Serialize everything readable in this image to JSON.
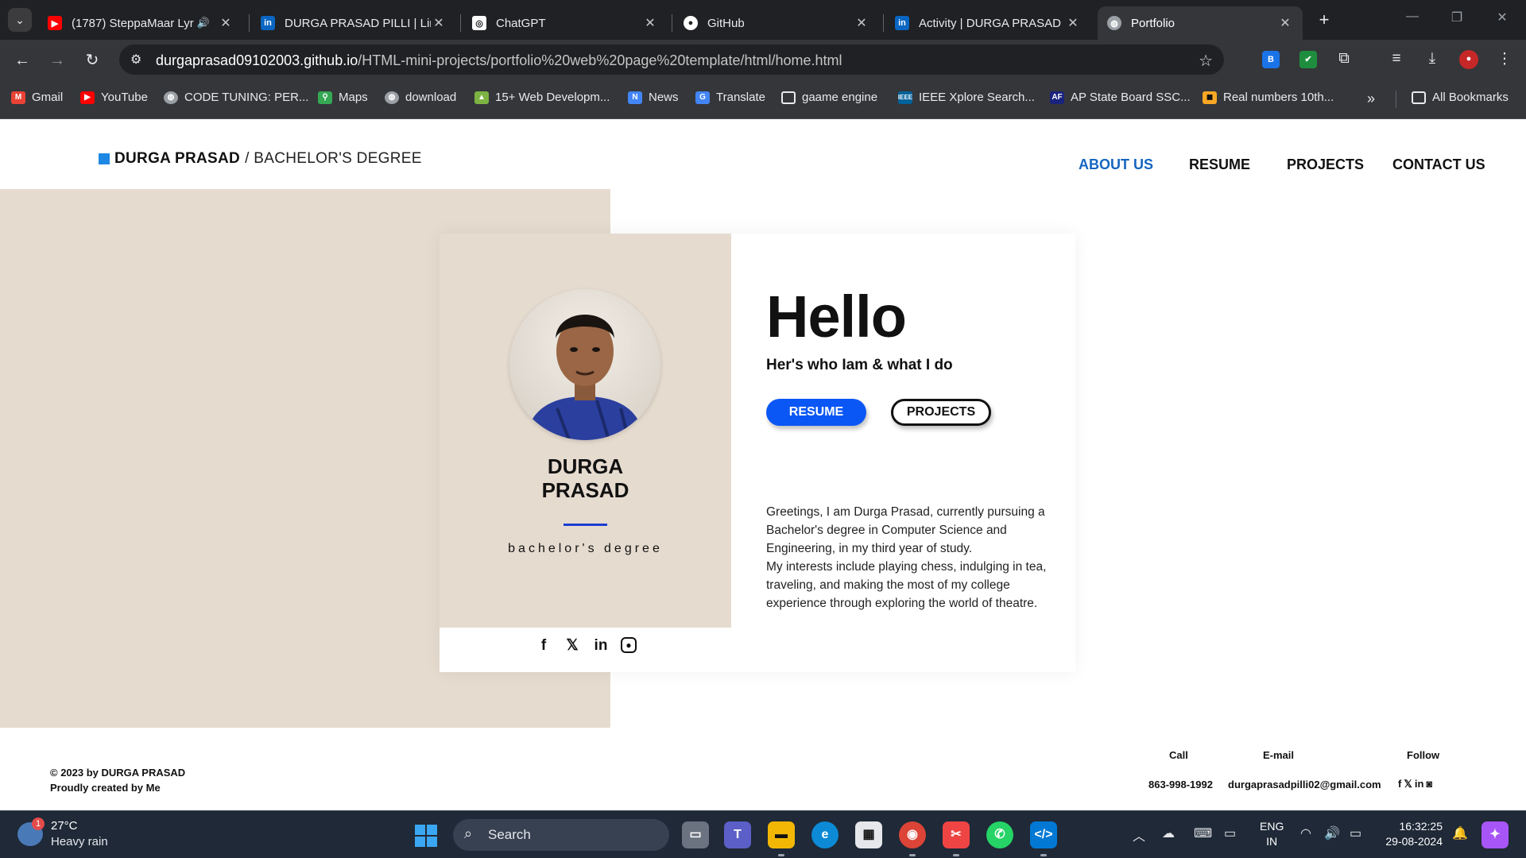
{
  "browser": {
    "tabs": [
      {
        "title": "(1787) SteppaMaar Lyr",
        "icon": "youtube-icon",
        "color": "#ff0000",
        "glyph": "▶",
        "audio": true
      },
      {
        "title": "DURGA PRASAD PILLI | Lin",
        "icon": "linkedin-icon",
        "color": "#0a66c2",
        "glyph": "in"
      },
      {
        "title": "ChatGPT",
        "icon": "chatgpt-icon",
        "color": "#ffffff",
        "glyph": "◎"
      },
      {
        "title": "GitHub",
        "icon": "github-icon",
        "color": "#ffffff",
        "glyph": "●"
      },
      {
        "title": "Activity | DURGA PRASAD",
        "icon": "linkedin-icon",
        "color": "#0a66c2",
        "glyph": "in"
      },
      {
        "title": "Portfolio",
        "icon": "globe-icon",
        "color": "#9aa0a6",
        "glyph": "◍",
        "active": true
      }
    ],
    "url_host": "durgaprasad09102003.github.io",
    "url_path": "/HTML-mini-projects/portfolio%20web%20page%20template/html/home.html",
    "bookmarks": [
      {
        "label": "Gmail",
        "icon": "gmail-icon",
        "color": "#ea4335"
      },
      {
        "label": "YouTube",
        "icon": "youtube-icon",
        "color": "#ff0000"
      },
      {
        "label": "CODE TUNING: PER...",
        "icon": "globe-icon",
        "color": "#9aa0a6"
      },
      {
        "label": "Maps",
        "icon": "maps-icon",
        "color": "#34a853"
      },
      {
        "label": "download",
        "icon": "globe-icon",
        "color": "#9aa0a6"
      },
      {
        "label": "15+ Web Developm...",
        "icon": "mountain-icon",
        "color": "#7cb342"
      },
      {
        "label": "News",
        "icon": "news-icon",
        "color": "#4285f4"
      },
      {
        "label": "Translate",
        "icon": "translate-icon",
        "color": "#4285f4"
      },
      {
        "label": "gaame engine",
        "icon": "folder-icon",
        "color": "#35363a"
      },
      {
        "label": "IEEE Xplore Search...",
        "icon": "ieee-icon",
        "color": "#00629b"
      },
      {
        "label": "AP State Board SSC...",
        "icon": "ap-icon",
        "color": "#1a237e"
      },
      {
        "label": "Real numbers 10th...",
        "icon": "book-icon",
        "color": "#f9a825"
      }
    ],
    "all_bookmarks": "All Bookmarks"
  },
  "site": {
    "brand_name": "DURGA PRASAD",
    "brand_sep": "/",
    "brand_degree": "BACHELOR'S DEGREE",
    "nav": [
      "ABOUT US",
      "RESUME",
      "PROJECTS",
      "CONTACT US"
    ],
    "active_nav": "ABOUT US",
    "card_name_line1": "DURGA",
    "card_name_line2": "PRASAD",
    "card_subtitle": "bachelor's degree",
    "hello": "Hello",
    "tagline": "Her's who Iam & what I do",
    "btn_resume": "RESUME",
    "btn_projects": "PROJECTS",
    "bio_p1": "Greetings, I am Durga Prasad, currently pursuing a Bachelor's degree in Computer Science and Engineering, in my third year of study.",
    "bio_p2": "My interests include playing chess, indulging in tea, traveling, and making the most of my college experience through exploring the world of theatre.",
    "accent": "#0b57f5"
  },
  "footer": {
    "copyright": "© 2023 by DURGA PRASAD",
    "credit": "Proudly created by Me",
    "call_label": "Call",
    "call_value": "863-998-1992",
    "email_label": "E-mail",
    "email_value": "durgaprasadpilli02@gmail.com",
    "follow_label": "Follow"
  },
  "taskbar": {
    "weather_temp": "27°C",
    "weather_desc": "Heavy rain",
    "weather_badge": "1",
    "search_label": "Search",
    "lang_top": "ENG",
    "lang_bottom": "IN",
    "time": "16:32:25",
    "date": "29-08-2024"
  }
}
